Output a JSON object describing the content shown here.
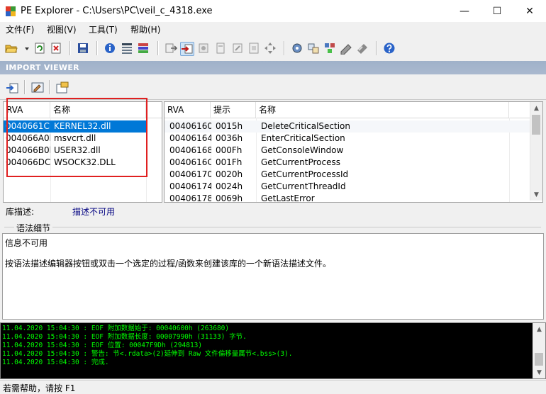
{
  "window": {
    "title": "PE Explorer - C:\\Users\\PC\\veil_c_4318.exe",
    "minimize_glyph": "—",
    "maximize_glyph": "☐",
    "close_glyph": "✕"
  },
  "menu": [
    {
      "label": "文件(F)"
    },
    {
      "label": "视图(V)"
    },
    {
      "label": "工具(T)"
    },
    {
      "label": "帮助(H)"
    }
  ],
  "viewer": {
    "header": "IMPORT VIEWER"
  },
  "dll_table": {
    "columns": [
      "RVA",
      "名称"
    ],
    "rows": [
      {
        "rva": "0040661Ch",
        "name": "KERNEL32.dll",
        "selected": true
      },
      {
        "rva": "004066A0h",
        "name": "msvcrt.dll",
        "selected": false
      },
      {
        "rva": "004066B0h",
        "name": "USER32.dll",
        "selected": false
      },
      {
        "rva": "004066DCh",
        "name": "WSOCK32.DLL",
        "selected": false
      }
    ]
  },
  "func_table": {
    "columns": [
      "RVA",
      "提示",
      "名称"
    ],
    "rows": [
      {
        "rva": "00406160h",
        "hint": "0015h",
        "name": "DeleteCriticalSection"
      },
      {
        "rva": "00406164h",
        "hint": "0036h",
        "name": "EnterCriticalSection"
      },
      {
        "rva": "00406168h",
        "hint": "000Fh",
        "name": "GetConsoleWindow"
      },
      {
        "rva": "0040616Ch",
        "hint": "001Fh",
        "name": "GetCurrentProcess"
      },
      {
        "rva": "00406170h",
        "hint": "0020h",
        "name": "GetCurrentProcessId"
      },
      {
        "rva": "00406174h",
        "hint": "0024h",
        "name": "GetCurrentThreadId"
      },
      {
        "rva": "00406178h",
        "hint": "0069h",
        "name": "GetLastError"
      }
    ]
  },
  "description": {
    "label": "库描述:",
    "value": "描述不可用"
  },
  "syntax": {
    "legend": "语法细节",
    "line1": "信息不可用",
    "line2": "按语法描述编辑器按钮或双击一个选定的过程/函数来创建该库的一个新语法描述文件。"
  },
  "log": [
    "11.04.2020 15:04:30 : EOF 附加数据始于: 00040600h  (263680)",
    "11.04.2020 15:04:30 : EOF 附加数据长度: 00007990h  (31133) 字节.",
    "11.04.2020 15:04:30 : EOF 位置: 00047F9Dh  (294813)",
    "11.04.2020 15:04:30 : 警告: 节<.rdata>(2)延伸到 Raw 文件偏移量属节<.bss>(3).",
    "11.04.2020 15:04:30 : 完成."
  ],
  "status": {
    "text": "若需帮助，请按 F1"
  },
  "colors": {
    "selection": "#0078d7",
    "log_text": "#00ff00",
    "highlight_box": "#e02020",
    "header_band": "#a3b4cc"
  }
}
